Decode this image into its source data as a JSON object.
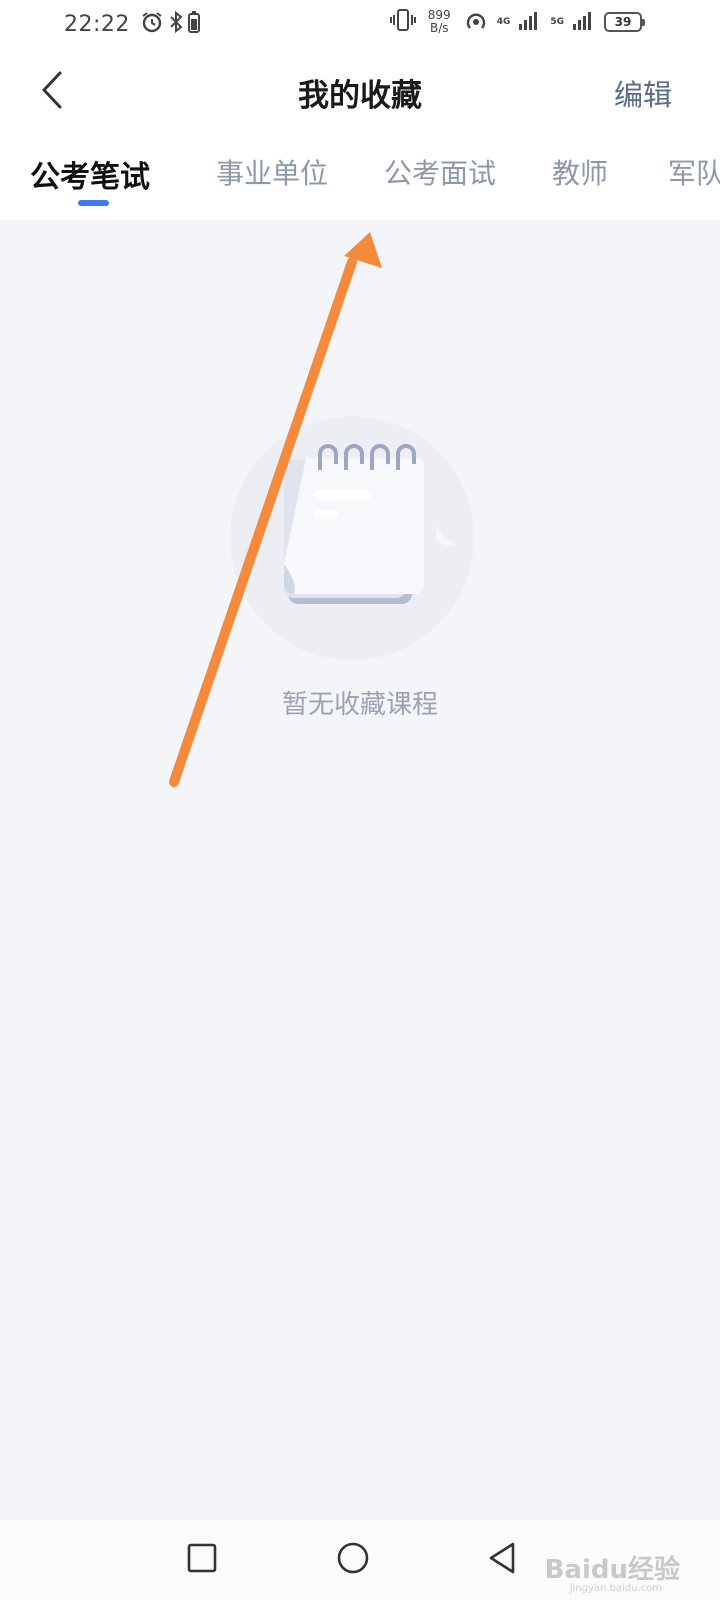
{
  "status_bar": {
    "time": "22:22",
    "net_speed_value": "899",
    "net_speed_unit": "B/s",
    "sim1_tag": "4G",
    "sim2_tag": "5G",
    "battery_level": "39",
    "icons": [
      "alarm-icon",
      "bluetooth-icon",
      "vibrate-icon",
      "hotspot-icon",
      "signal-icon",
      "battery-icon"
    ]
  },
  "header": {
    "title": "我的收藏",
    "edit_label": "编辑"
  },
  "tabs": [
    {
      "label": "公考笔试",
      "active": true
    },
    {
      "label": "事业单位",
      "active": false
    },
    {
      "label": "公考面试",
      "active": false
    },
    {
      "label": "教师",
      "active": false
    },
    {
      "label": "军队",
      "active": false
    }
  ],
  "empty_state": {
    "message": "暂无收藏课程"
  },
  "nav_bar": {
    "buttons": [
      "recents-button",
      "home-button",
      "back-button"
    ]
  },
  "watermark": {
    "text": "Baidu经验",
    "sub": "jingyan.baidu.com"
  },
  "colors": {
    "accent": "#3d7bf2",
    "annotation_arrow": "#f58a3c",
    "background": "#f4f5f9"
  }
}
